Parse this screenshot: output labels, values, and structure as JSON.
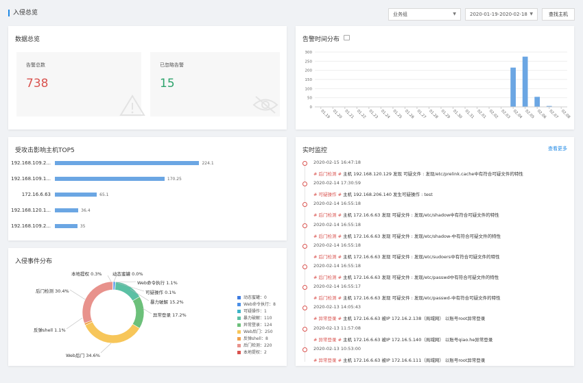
{
  "header": {
    "title": "入侵总览",
    "group_select": "业务组",
    "date_range": "2020-01-19-2020-02-18",
    "search_host_button": "查找主机"
  },
  "overview": {
    "title": "数据总览",
    "total_alerts_label": "告警总数",
    "total_alerts_value": "738",
    "ignored_alerts_label": "已忽略告警",
    "ignored_alerts_value": "15",
    "colors": {
      "total": "#d9534f",
      "ignored": "#2ca36b"
    }
  },
  "alert_time": {
    "title": "告警时间分布",
    "chart_data": {
      "type": "bar",
      "categories": [
        "01.19",
        "01.20",
        "01.21",
        "01.22",
        "01.23",
        "01.24",
        "01.25",
        "01.26",
        "01.27",
        "01.28",
        "01.29",
        "01.30",
        "01.31",
        "02.01",
        "02.02",
        "02.03",
        "02.04",
        "02.05",
        "02.06",
        "02.07",
        "02.08"
      ],
      "values": [
        0,
        0,
        0,
        0,
        0,
        0,
        0,
        0,
        0,
        0,
        0,
        0,
        0,
        0,
        0,
        0,
        215,
        275,
        55,
        5,
        0
      ],
      "ylim": [
        0,
        300
      ],
      "yticks": [
        0,
        50,
        100,
        150,
        200,
        250,
        300
      ],
      "color": "#6ba6e3",
      "grid": true
    }
  },
  "top5": {
    "title": "受攻击影响主机TOP5",
    "chart_data": {
      "type": "bar",
      "orientation": "horizontal",
      "categories": [
        "192.168.109.2...",
        "192.168.109.1...",
        "172.16.6.63",
        "192.168.120.1...",
        "192.168.109.2..."
      ],
      "values": [
        224.1,
        170.25,
        65.1,
        36.4,
        35
      ],
      "labels": [
        "224.1",
        "170.25",
        "65.1",
        "36.4",
        "35"
      ],
      "color": "#6ba6e3"
    }
  },
  "monitor": {
    "title": "实时监控",
    "more_link": "查看更多",
    "items": [
      {
        "time": "2020-02-15 16:47:18",
        "tag": "# 后门检测 #",
        "text": " 主机 192.168.120.129 发现 可疑文件 : 发现/etc/prelink.cache中有符合可疑文件的特性"
      },
      {
        "time": "2020-02-14 17:30:59",
        "tag": "# 可疑操作 #",
        "text": " 主机 192.168.206.140 发生可疑操作 : test"
      },
      {
        "time": "2020-02-14 16:55:18",
        "tag": "# 后门检测 #",
        "text": " 主机 172.16.6.63 发现 可疑文件 : 发现/etc/shadow中有符合可疑文件的特性"
      },
      {
        "time": "2020-02-14 16:55:18",
        "tag": "# 后门检测 #",
        "text": " 主机 172.16.6.63 发现 可疑文件 : 发现/etc/shadow-中有符合可疑文件的特性"
      },
      {
        "time": "2020-02-14 16:55:18",
        "tag": "# 后门检测 #",
        "text": " 主机 172.16.6.63 发现 可疑文件 : 发现/etc/sudoers中有符合可疑文件的特性"
      },
      {
        "time": "2020-02-14 16:55:18",
        "tag": "# 后门检测 #",
        "text": " 主机 172.16.6.63 发现 可疑文件 : 发现/etc/passwd中有符合可疑文件的特性"
      },
      {
        "time": "2020-02-14 16:55:17",
        "tag": "# 后门检测 #",
        "text": " 主机 172.16.6.63 发现 可疑文件 : 发现/etc/passwd-中有符合可疑文件的特性"
      },
      {
        "time": "2020-02-13 14:05:43",
        "tag": "# 异常登录 #",
        "text": " 主机 172.16.6.63 被IP 172.16.2.138（局域网） 以账号root异常登录"
      },
      {
        "time": "2020-02-13 11:57:08",
        "tag": "# 异常登录 #",
        "text": " 主机 172.16.6.63 被IP 172.16.5.140（局域网） 以账号qiao.he异常登录"
      },
      {
        "time": "2020-02-13 10:53:00",
        "tag": "# 异常登录 #",
        "text": " 主机 172.16.6.63 被IP 172.16.6.111（局域网） 以账号root异常登录"
      }
    ]
  },
  "intrusion": {
    "title": "入侵事件分布",
    "chart_data": {
      "type": "pie",
      "donut": true,
      "slices": [
        {
          "name": "动态蜜罐",
          "value": 0,
          "percent": "0.0%",
          "color": "#3d7be0"
        },
        {
          "name": "Web命令执行",
          "value": 8,
          "percent": "1.1%",
          "color": "#4a8fe7"
        },
        {
          "name": "可疑操作",
          "value": 1,
          "percent": "0.1%",
          "color": "#3db4c9"
        },
        {
          "name": "暴力破解",
          "value": 110,
          "percent": "15.2%",
          "color": "#5bc0a4"
        },
        {
          "name": "异常登录",
          "value": 124,
          "percent": "17.2%",
          "color": "#6cc07a"
        },
        {
          "name": "Web后门",
          "value": 250,
          "percent": "34.6%",
          "color": "#f7c65a"
        },
        {
          "name": "反弹shell",
          "value": 8,
          "percent": "1.1%",
          "color": "#f0a04b"
        },
        {
          "name": "后门检测",
          "value": 220,
          "percent": "30.4%",
          "color": "#e8928c"
        },
        {
          "name": "本地提权",
          "value": 2,
          "percent": "0.3%",
          "color": "#d9534f"
        }
      ]
    },
    "legend": [
      "动态蜜罐：0",
      "Web命令执行：8",
      "可疑操作：1",
      "暴力破解：110",
      "异常登录：124",
      "Web后门：250",
      "反弹shell：8",
      "后门检测：220",
      "本地提权：2"
    ],
    "outer_labels": {
      "local_priv": "本地提权 0.3%",
      "honeypot": "动态蜜罐 0.0%",
      "web_cmd": "Web命令执行 1.1%",
      "suspicious": "可疑操作 0.1%",
      "brute": "暴力破解 15.2%",
      "abnormal_login": "异常登录 17.2%",
      "web_backdoor": "Web后门 34.6%",
      "reverse_shell": "反弹shell 1.1%",
      "backdoor": "后门检测 30.4%"
    }
  }
}
